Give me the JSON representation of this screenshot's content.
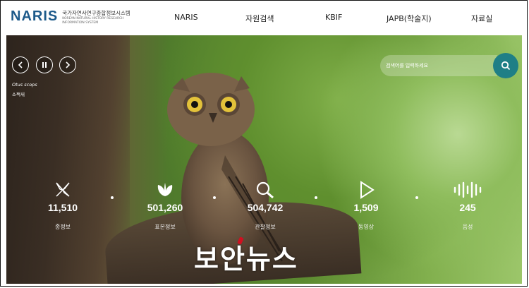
{
  "header": {
    "logo": {
      "word": "NARIS",
      "korean": "국가자연사연구종합정보시스템",
      "english": "Korean Natural History Research Information System"
    },
    "nav": [
      {
        "label": "NARIS"
      },
      {
        "label": "자원검색"
      },
      {
        "label": "KBIF"
      },
      {
        "label": "JAPB(학술지)"
      },
      {
        "label": "자료실"
      }
    ]
  },
  "hero": {
    "species": {
      "scientific": "Otus scops",
      "korean": "소쩍새"
    },
    "search": {
      "placeholder": "검색어를 입력하세요"
    },
    "controls": [
      "prev-icon",
      "pause-icon",
      "next-icon"
    ],
    "stats": [
      {
        "icon": "species-icon",
        "value": "11,510",
        "label": "종정보"
      },
      {
        "icon": "specimen-leaf-icon",
        "value": "501,260",
        "label": "표본정보"
      },
      {
        "icon": "magnifier-icon",
        "value": "504,742",
        "label": "관찰정보"
      },
      {
        "icon": "play-icon",
        "value": "1,509",
        "label": "동영상"
      },
      {
        "icon": "sound-wave-icon",
        "value": "245",
        "label": "음성"
      }
    ]
  },
  "watermark": "보안뉴스",
  "colors": {
    "brand": "#1d5a8a",
    "search_button": "#1f7f86"
  }
}
